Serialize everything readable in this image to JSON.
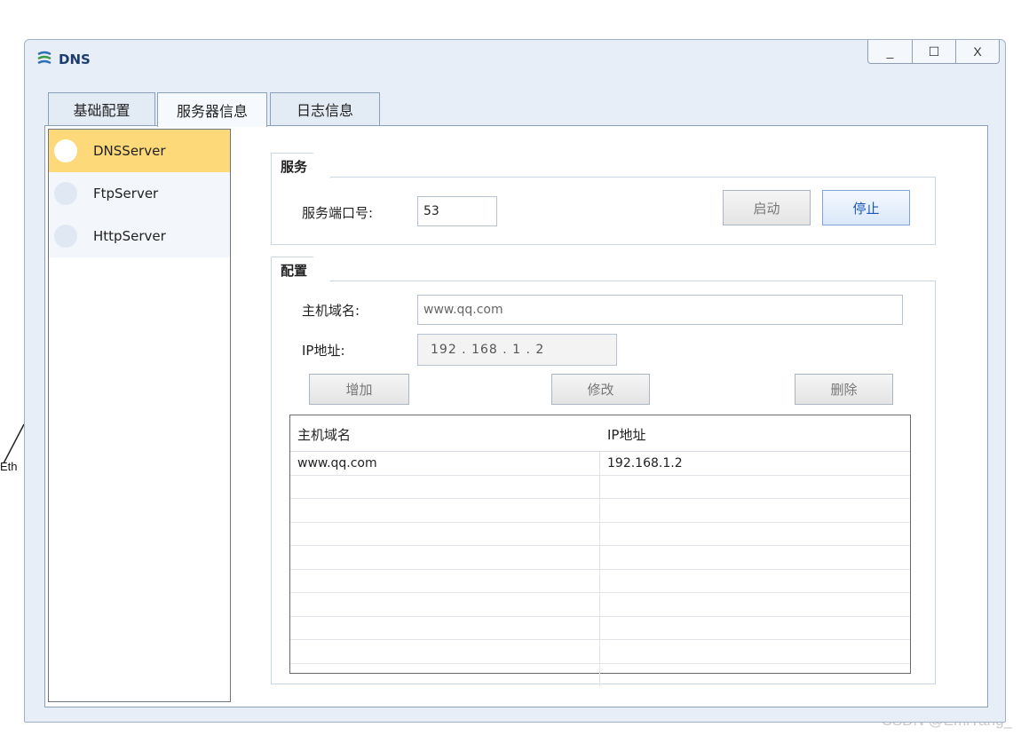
{
  "window": {
    "title": "DNS",
    "controls": {
      "minimize": "_",
      "maximize": "☐",
      "close": "X"
    }
  },
  "tabs": [
    {
      "label": "基础配置",
      "active": false
    },
    {
      "label": "服务器信息",
      "active": true
    },
    {
      "label": "日志信息",
      "active": false
    }
  ],
  "sidebar": {
    "items": [
      {
        "label": "DNSServer",
        "active": true
      },
      {
        "label": "FtpServer",
        "active": false
      },
      {
        "label": "HttpServer",
        "active": false
      }
    ]
  },
  "service": {
    "legend": "服务",
    "port_label": "服务端口号:",
    "port_value": "53",
    "start_label": "启动",
    "stop_label": "停止"
  },
  "config": {
    "legend": "配置",
    "host_label": "主机域名:",
    "host_value": "www.qq.com",
    "ip_label": "IP地址:",
    "ip_value": "192 . 168 . 1 . 2",
    "add_label": "增加",
    "modify_label": "修改",
    "delete_label": "删除"
  },
  "table": {
    "headers": [
      "主机域名",
      "IP地址"
    ],
    "rows": [
      [
        "www.qq.com",
        "192.168.1.2"
      ]
    ]
  },
  "background": {
    "eth_label": "Eth",
    "watermark": "CSDN @EmiYang_"
  },
  "colors": {
    "accent_selected": "#fdd97a",
    "stop_button_text": "#1a56b8",
    "title_text": "#1d3c6e"
  },
  "icons": {
    "app": "dns-app-icon",
    "minimize": "minimize-icon",
    "maximize": "maximize-icon",
    "close": "close-icon"
  }
}
